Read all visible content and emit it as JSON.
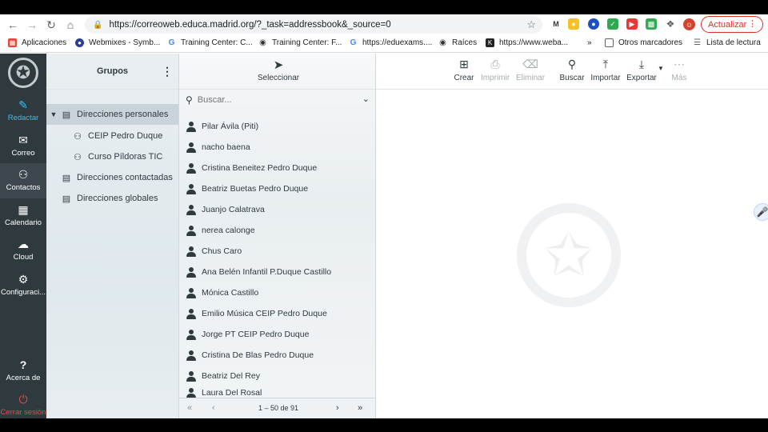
{
  "browser": {
    "url": "https://correoweb.educa.madrid.org/?_task=addressbook&_source=0",
    "update_label": "Actualizar",
    "bookmarks": [
      "Aplicaciones",
      "Webmixes - Symb...",
      "Training Center: C...",
      "Training Center: F...",
      "https://eduexams....",
      "Raíces",
      "https://www.weba..."
    ],
    "more_bookmarks": "»",
    "other_bookmarks": "Otros marcadores",
    "reading_list": "Lista de lectura"
  },
  "nav": {
    "compose": "Redactar",
    "mail": "Correo",
    "contacts": "Contactos",
    "calendar": "Calendario",
    "cloud": "Cloud",
    "settings": "Configuraci...",
    "about": "Acerca de",
    "logout": "Cerrar sesión"
  },
  "groups": {
    "title": "Grupos",
    "items": [
      {
        "label": "Direcciones personales"
      },
      {
        "label": "CEIP Pedro Duque"
      },
      {
        "label": "Curso Píldoras TIC"
      },
      {
        "label": "Direcciones contactadas"
      },
      {
        "label": "Direcciones globales"
      }
    ]
  },
  "contacts": {
    "select_label": "Seleccionar",
    "search_placeholder": "Buscar...",
    "items": [
      "Pilar Ávila (Piti)",
      "nacho baena",
      "Cristina Beneitez Pedro Duque",
      "Beatriz Buetas Pedro Duque",
      "Juanjo Calatrava",
      "nerea calonge",
      "Chus Caro",
      "Ana Belén Infantil P.Duque Castillo",
      "Mónica Castillo",
      "Emilio Música CEIP Pedro Duque",
      "Jorge PT CEIP Pedro Duque",
      "Cristina De Blas Pedro Duque",
      "Beatriz Del Rey",
      "Laura Del Rosal"
    ],
    "pager": "1 – 50 de 91"
  },
  "toolbar": {
    "create": "Crear",
    "print": "Imprimir",
    "delete": "Eliminar",
    "search": "Buscar",
    "import": "Importar",
    "export": "Exportar",
    "more": "Más"
  }
}
